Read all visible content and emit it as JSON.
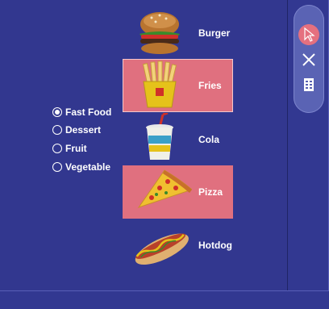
{
  "food_list": {
    "items": [
      {
        "id": "burger",
        "label": "Burger",
        "selected": false
      },
      {
        "id": "fries",
        "label": "Fries",
        "selected": true
      },
      {
        "id": "cola",
        "label": "Cola",
        "selected": false
      },
      {
        "id": "pizza",
        "label": "Pizza",
        "selected": true
      },
      {
        "id": "hotdog",
        "label": "Hotdog",
        "selected": false
      }
    ]
  },
  "category": {
    "options": [
      "Fast Food",
      "Dessert",
      "Fruit",
      "Vegetable"
    ],
    "selected": "Fast Food"
  },
  "toolbar": {
    "icons": [
      "pointer-icon",
      "close-icon",
      "document-icon"
    ],
    "active": "pointer-icon"
  },
  "colors": {
    "background": "#32378f",
    "selection": "#e0707f",
    "panel": "#5a63b4",
    "text": "#ffffff"
  }
}
